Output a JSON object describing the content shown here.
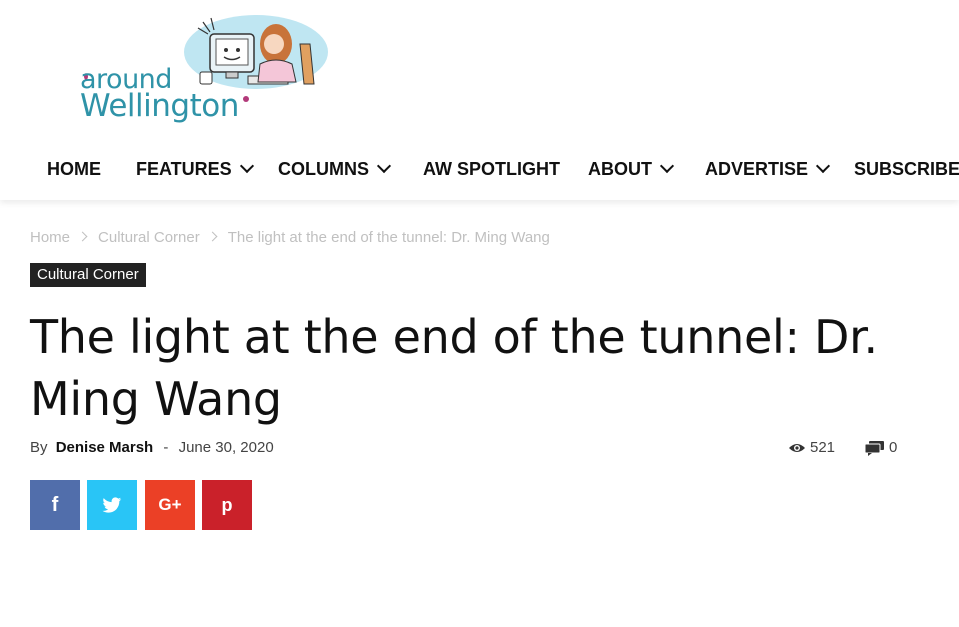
{
  "logo": {
    "line1": "around",
    "line2": "Wellington"
  },
  "nav": {
    "items": [
      {
        "label": "HOME"
      },
      {
        "label": "FEATURES"
      },
      {
        "label": "COLUMNS"
      },
      {
        "label": "AW SPOTLIGHT"
      },
      {
        "label": "ABOUT"
      },
      {
        "label": "ADVERTISE"
      },
      {
        "label": "SUBSCRIBE"
      }
    ]
  },
  "breadcrumb": {
    "home": "Home",
    "category": "Cultural Corner",
    "current": "The light at the end of the tunnel: Dr. Ming Wang"
  },
  "article": {
    "category": "Cultural Corner",
    "title": "The light at the end of the tunnel: Dr. Ming Wang",
    "by": "By",
    "author": "Denise Marsh",
    "dash": "-",
    "date": "June 30, 2020",
    "views": "521",
    "comments": "0"
  },
  "share": {
    "facebook": {
      "icon": "facebook-icon",
      "glyph": "f",
      "color": "#516eab"
    },
    "twitter": {
      "icon": "twitter-icon",
      "color": "#29c5f6"
    },
    "googleplus": {
      "icon": "google-plus-icon",
      "glyph": "G+",
      "color": "#eb4026"
    },
    "pinterest": {
      "icon": "pinterest-icon",
      "glyph": "p",
      "color": "#ca212a"
    }
  }
}
